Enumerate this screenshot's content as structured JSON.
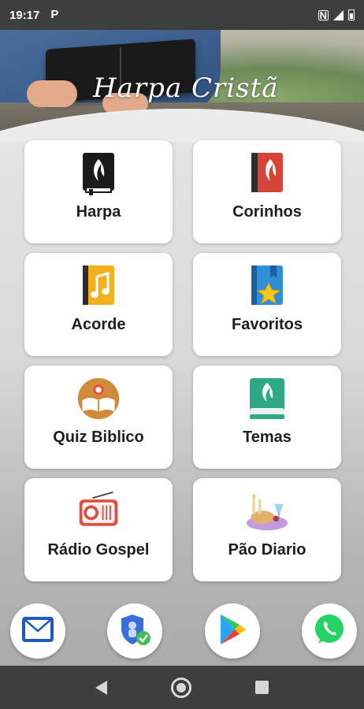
{
  "status_bar": {
    "time": "19:17",
    "notification_icon": "parking-icon",
    "notification_glyph": "P"
  },
  "header": {
    "title": "Harpa Cristã"
  },
  "menu": {
    "items": [
      {
        "label": "Harpa",
        "icon": "black-bible-book-icon"
      },
      {
        "label": "Corinhos",
        "icon": "red-bible-book-icon"
      },
      {
        "label": "Acorde",
        "icon": "music-note-book-icon"
      },
      {
        "label": "Favoritos",
        "icon": "star-bookmark-book-icon"
      },
      {
        "label": "Quiz Biblico",
        "icon": "open-book-quiz-icon"
      },
      {
        "label": "Temas",
        "icon": "green-book-icon"
      },
      {
        "label": "Rádio Gospel",
        "icon": "radio-icon"
      },
      {
        "label": "Pão Diario",
        "icon": "bread-wine-icon"
      }
    ]
  },
  "bottom_actions": [
    {
      "icon": "mail-icon"
    },
    {
      "icon": "security-shield-icon"
    },
    {
      "icon": "play-store-icon"
    },
    {
      "icon": "whatsapp-icon"
    }
  ],
  "colors": {
    "status_bar": "#3e3e3e",
    "tile_bg": "#ffffff",
    "whatsapp_green": "#25d366",
    "mail_blue": "#1e5bbf"
  }
}
